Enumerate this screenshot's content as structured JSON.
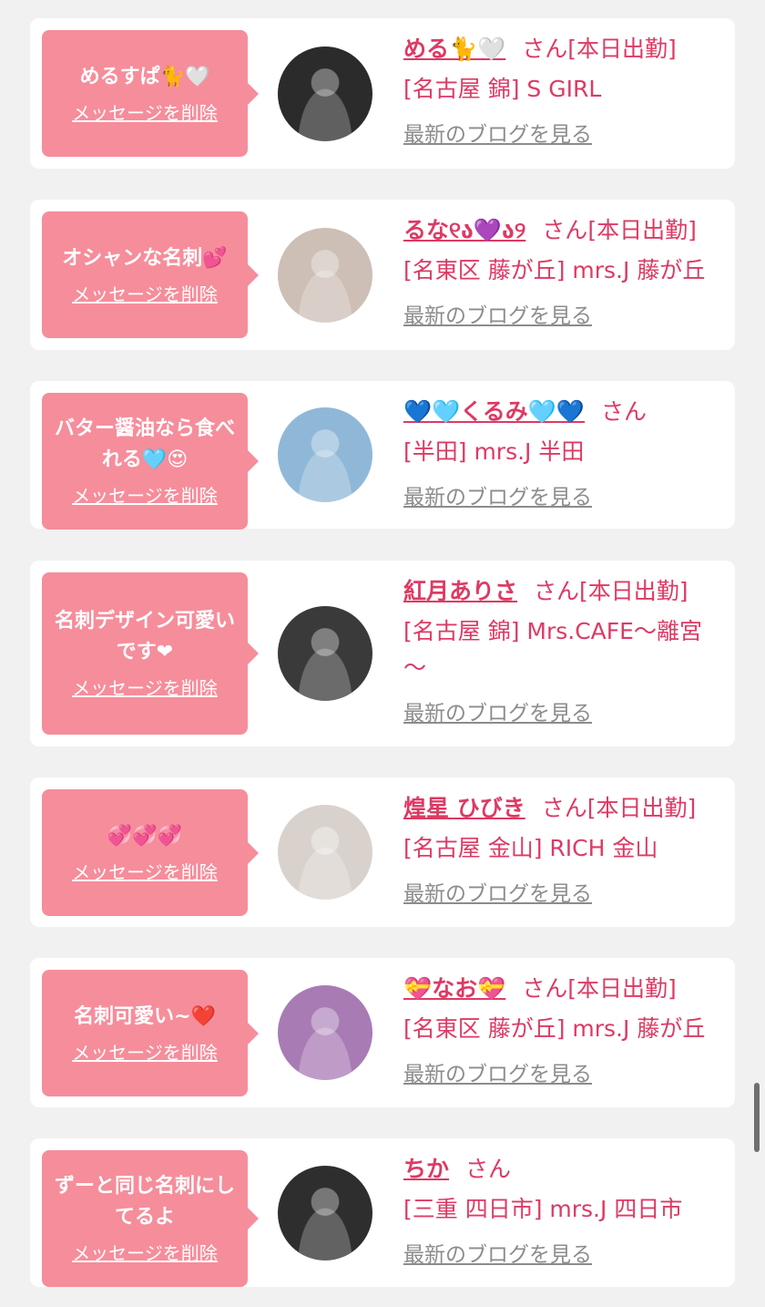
{
  "messages": [
    {
      "bubble_text": "めるすぱ🐈🤍",
      "delete_label": "メッセージを削除",
      "name": "める🐈🤍",
      "suffix": "さん",
      "status": "[本日出勤]",
      "shop": "[名古屋 錦] S GIRL",
      "blog_label": "最新のブログを見る",
      "avatar_color": "#2b2b2b"
    },
    {
      "bubble_text": "オシャンな名刺💕",
      "delete_label": "メッセージを削除",
      "name": "るな୧ა💜ა୨",
      "suffix": "さん",
      "status": "[本日出勤]",
      "shop": "[名東区 藤が丘] mrs.J 藤が丘",
      "blog_label": "最新のブログを見る",
      "avatar_color": "#cdbfb6"
    },
    {
      "bubble_text": "バター醤油なら食べれる🩵😍",
      "delete_label": "メッセージを削除",
      "name": "💙🩵くるみ🩵💙",
      "suffix": "さん",
      "status": "",
      "shop": "[半田] mrs.J 半田",
      "blog_label": "最新のブログを見る",
      "avatar_color": "#8fb8d8"
    },
    {
      "bubble_text": "名刺デザイン可愛いです❤",
      "delete_label": "メッセージを削除",
      "name": "紅月ありさ",
      "suffix": "さん",
      "status": "[本日出勤]",
      "shop": "[名古屋 錦] Mrs.CAFE～離宮～",
      "blog_label": "最新のブログを見る",
      "avatar_color": "#3a3a3a"
    },
    {
      "bubble_text": "💞💞💞",
      "delete_label": "メッセージを削除",
      "name": "煌星 ひびき",
      "suffix": "さん",
      "status": "[本日出勤]",
      "shop": "[名古屋 金山] RICH 金山",
      "blog_label": "最新のブログを見る",
      "avatar_color": "#d9d2cc"
    },
    {
      "bubble_text": "名刺可愛い~❤️",
      "delete_label": "メッセージを削除",
      "name": "💝なお💝",
      "suffix": "さん",
      "status": "[本日出勤]",
      "shop": "[名東区 藤が丘] mrs.J 藤が丘",
      "blog_label": "最新のブログを見る",
      "avatar_color": "#a87bb4"
    },
    {
      "bubble_text": "ずーと同じ名刺にしてるよ",
      "delete_label": "メッセージを削除",
      "name": "ちか",
      "suffix": "さん",
      "status": "",
      "shop": "[三重 四日市] mrs.J 四日市",
      "blog_label": "最新のブログを見る",
      "avatar_color": "#2e2e2e"
    }
  ]
}
